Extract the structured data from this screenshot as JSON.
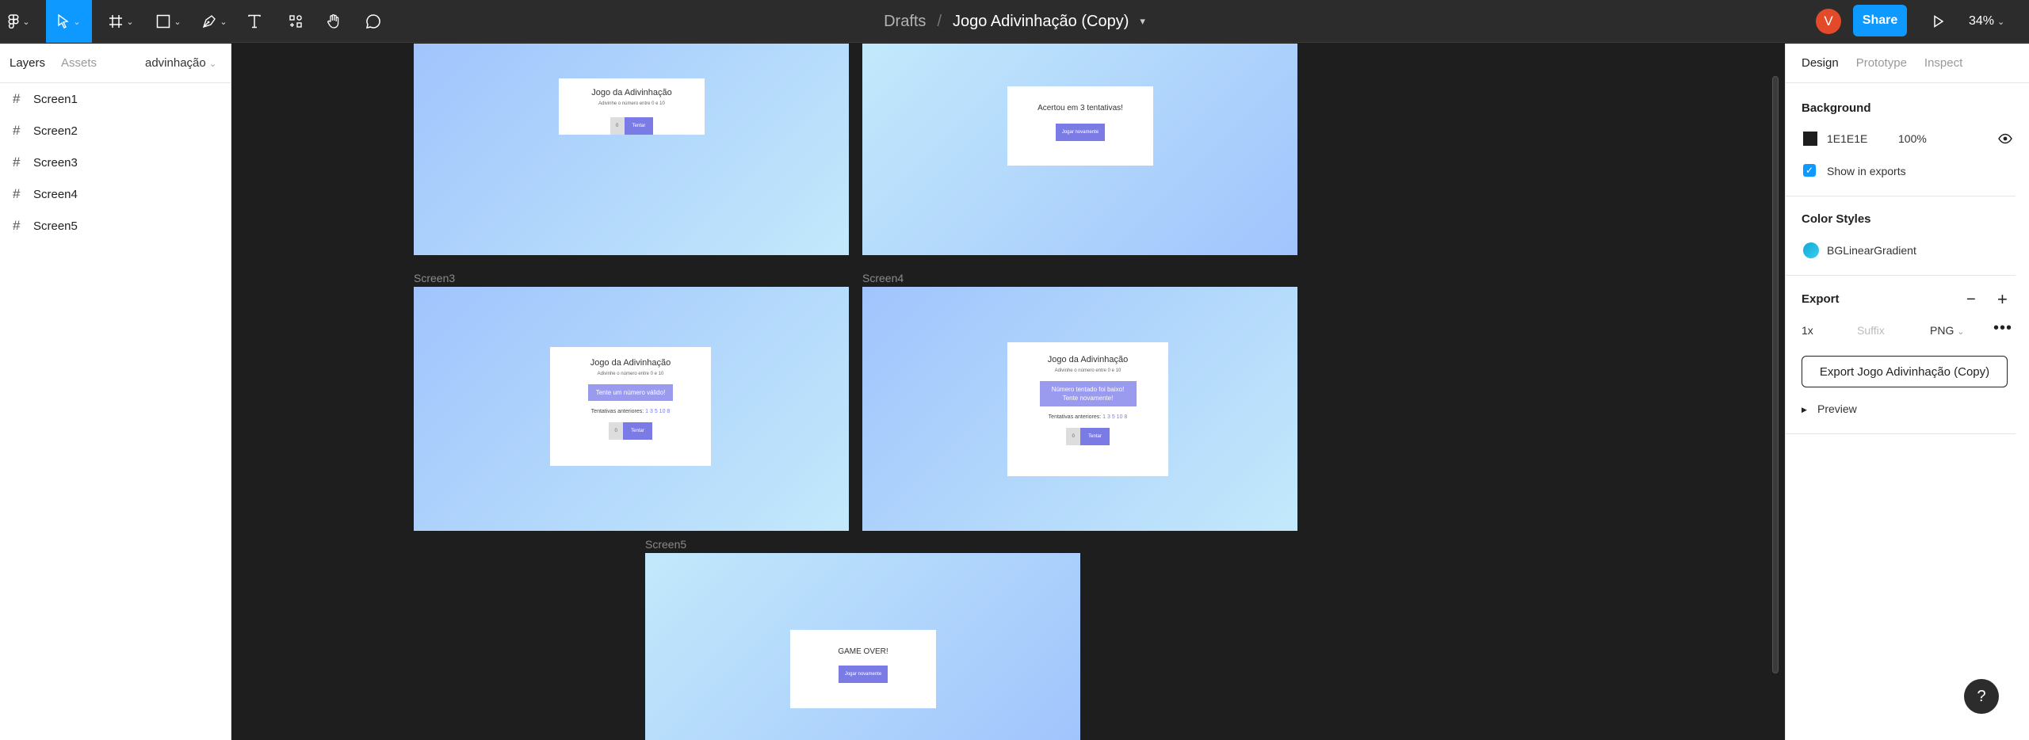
{
  "topbar": {
    "breadcrumb_root": "Drafts",
    "separator": "/",
    "file_name": "Jogo Adivinhação (Copy)",
    "avatar_initial": "V",
    "share_label": "Share",
    "zoom_label": "34%"
  },
  "left_panel": {
    "tabs": [
      "Layers",
      "Assets"
    ],
    "page_name": "advinhação",
    "layers": [
      "Screen1",
      "Screen2",
      "Screen3",
      "Screen4",
      "Screen5"
    ]
  },
  "canvas": {
    "frame_labels": [
      "Screen3",
      "Screen4",
      "Screen5"
    ],
    "game_title": "Jogo da Adivinhação",
    "game_subtitle": "Adivinhe o número entre 0 e 10",
    "input_value": "0",
    "try_button": "Tentar",
    "win_message": "Acertou em 3 tentativas!",
    "play_again": "Jogar novamente",
    "invalid_message": "Tente um número válido!",
    "low_message_1": "Número tentado foi baixo!",
    "low_message_2": "Tente novamente!",
    "history_label": "Tentativas anteriores:",
    "history_values": "1 3 5 10 8",
    "game_over": "GAME OVER!"
  },
  "right_panel": {
    "tabs": [
      "Design",
      "Prototype",
      "Inspect"
    ],
    "background_title": "Background",
    "bg_hex": "1E1E1E",
    "bg_opacity": "100%",
    "show_in_exports": "Show in exports",
    "color_styles_title": "Color Styles",
    "color_style_name": "BGLinearGradient",
    "export_title": "Export",
    "export_scale": "1x",
    "suffix_placeholder": "Suffix",
    "export_format": "PNG",
    "export_button": "Export Jogo Adivinhação (Copy)",
    "preview_label": "Preview"
  },
  "colors": {
    "accent": "#0d99ff",
    "button_purple": "#7b7be6",
    "canvas_bg": "#1e1e1e"
  }
}
